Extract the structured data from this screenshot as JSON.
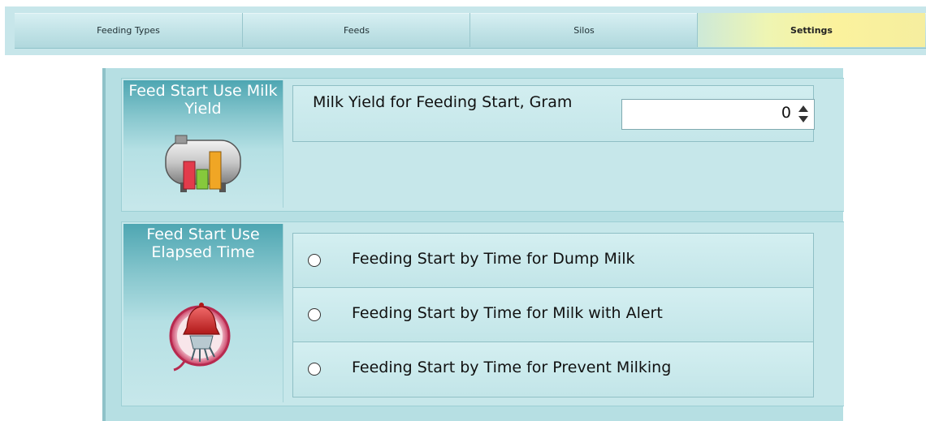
{
  "tabs": [
    {
      "label": "Feeding Types",
      "active": false
    },
    {
      "label": "Feeds",
      "active": false
    },
    {
      "label": "Silos",
      "active": false
    },
    {
      "label": "Settings",
      "active": true
    }
  ],
  "milk_yield_section": {
    "title": "Feed Start Use Milk Yield",
    "icon": "milk-tank-chart-icon",
    "field_label": "Milk Yield for Feeding Start, Gram",
    "value": "0"
  },
  "elapsed_time_section": {
    "title": "Feed Start Use Elapsed Time",
    "icon": "alarm-milking-icon",
    "options": [
      {
        "label": "Feeding Start by Time for Dump Milk",
        "selected": false
      },
      {
        "label": "Feeding Start by Time for Milk with Alert",
        "selected": false
      },
      {
        "label": "Feeding Start by Time for Prevent Milking",
        "selected": false
      }
    ]
  },
  "colors": {
    "active_tab": "#fbf29d",
    "panel_bg": "#b6dfe3",
    "header_teal": "#4ea6b2"
  }
}
